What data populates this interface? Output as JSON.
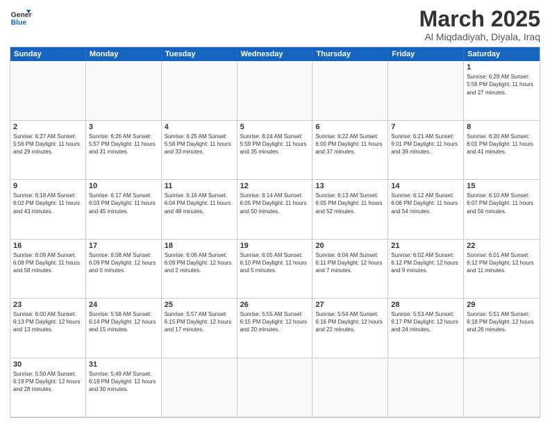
{
  "header": {
    "logo_general": "General",
    "logo_blue": "Blue",
    "month_title": "March 2025",
    "location": "Al Miqdadiyah, Diyala, Iraq"
  },
  "weekdays": [
    "Sunday",
    "Monday",
    "Tuesday",
    "Wednesday",
    "Thursday",
    "Friday",
    "Saturday"
  ],
  "cells": [
    {
      "day": "",
      "info": ""
    },
    {
      "day": "",
      "info": ""
    },
    {
      "day": "",
      "info": ""
    },
    {
      "day": "",
      "info": ""
    },
    {
      "day": "",
      "info": ""
    },
    {
      "day": "",
      "info": ""
    },
    {
      "day": "1",
      "info": "Sunrise: 6:29 AM\nSunset: 5:56 PM\nDaylight: 11 hours\nand 27 minutes."
    },
    {
      "day": "2",
      "info": "Sunrise: 6:27 AM\nSunset: 5:56 PM\nDaylight: 11 hours\nand 29 minutes."
    },
    {
      "day": "3",
      "info": "Sunrise: 6:26 AM\nSunset: 5:57 PM\nDaylight: 11 hours\nand 31 minutes."
    },
    {
      "day": "4",
      "info": "Sunrise: 6:25 AM\nSunset: 5:58 PM\nDaylight: 11 hours\nand 33 minutes."
    },
    {
      "day": "5",
      "info": "Sunrise: 6:24 AM\nSunset: 5:59 PM\nDaylight: 11 hours\nand 35 minutes."
    },
    {
      "day": "6",
      "info": "Sunrise: 6:22 AM\nSunset: 6:00 PM\nDaylight: 11 hours\nand 37 minutes."
    },
    {
      "day": "7",
      "info": "Sunrise: 6:21 AM\nSunset: 6:01 PM\nDaylight: 11 hours\nand 39 minutes."
    },
    {
      "day": "8",
      "info": "Sunrise: 6:20 AM\nSunset: 6:01 PM\nDaylight: 11 hours\nand 41 minutes."
    },
    {
      "day": "9",
      "info": "Sunrise: 6:18 AM\nSunset: 6:02 PM\nDaylight: 11 hours\nand 43 minutes."
    },
    {
      "day": "10",
      "info": "Sunrise: 6:17 AM\nSunset: 6:03 PM\nDaylight: 11 hours\nand 45 minutes."
    },
    {
      "day": "11",
      "info": "Sunrise: 6:16 AM\nSunset: 6:04 PM\nDaylight: 11 hours\nand 48 minutes."
    },
    {
      "day": "12",
      "info": "Sunrise: 6:14 AM\nSunset: 6:05 PM\nDaylight: 11 hours\nand 50 minutes."
    },
    {
      "day": "13",
      "info": "Sunrise: 6:13 AM\nSunset: 6:05 PM\nDaylight: 11 hours\nand 52 minutes."
    },
    {
      "day": "14",
      "info": "Sunrise: 6:12 AM\nSunset: 6:06 PM\nDaylight: 11 hours\nand 54 minutes."
    },
    {
      "day": "15",
      "info": "Sunrise: 6:10 AM\nSunset: 6:07 PM\nDaylight: 11 hours\nand 56 minutes."
    },
    {
      "day": "16",
      "info": "Sunrise: 6:09 AM\nSunset: 6:08 PM\nDaylight: 11 hours\nand 58 minutes."
    },
    {
      "day": "17",
      "info": "Sunrise: 6:08 AM\nSunset: 6:09 PM\nDaylight: 12 hours\nand 0 minutes."
    },
    {
      "day": "18",
      "info": "Sunrise: 6:06 AM\nSunset: 6:09 PM\nDaylight: 12 hours\nand 2 minutes."
    },
    {
      "day": "19",
      "info": "Sunrise: 6:05 AM\nSunset: 6:10 PM\nDaylight: 12 hours\nand 5 minutes."
    },
    {
      "day": "20",
      "info": "Sunrise: 6:04 AM\nSunset: 6:11 PM\nDaylight: 12 hours\nand 7 minutes."
    },
    {
      "day": "21",
      "info": "Sunrise: 6:02 AM\nSunset: 6:12 PM\nDaylight: 12 hours\nand 9 minutes."
    },
    {
      "day": "22",
      "info": "Sunrise: 6:01 AM\nSunset: 6:12 PM\nDaylight: 12 hours\nand 11 minutes."
    },
    {
      "day": "23",
      "info": "Sunrise: 6:00 AM\nSunset: 6:13 PM\nDaylight: 12 hours\nand 13 minutes."
    },
    {
      "day": "24",
      "info": "Sunrise: 5:58 AM\nSunset: 6:14 PM\nDaylight: 12 hours\nand 15 minutes."
    },
    {
      "day": "25",
      "info": "Sunrise: 5:57 AM\nSunset: 6:15 PM\nDaylight: 12 hours\nand 17 minutes."
    },
    {
      "day": "26",
      "info": "Sunrise: 5:55 AM\nSunset: 6:15 PM\nDaylight: 12 hours\nand 20 minutes."
    },
    {
      "day": "27",
      "info": "Sunrise: 5:54 AM\nSunset: 6:16 PM\nDaylight: 12 hours\nand 22 minutes."
    },
    {
      "day": "28",
      "info": "Sunrise: 5:53 AM\nSunset: 6:17 PM\nDaylight: 12 hours\nand 24 minutes."
    },
    {
      "day": "29",
      "info": "Sunrise: 5:51 AM\nSunset: 6:18 PM\nDaylight: 12 hours\nand 26 minutes."
    },
    {
      "day": "30",
      "info": "Sunrise: 5:50 AM\nSunset: 6:19 PM\nDaylight: 12 hours\nand 28 minutes."
    },
    {
      "day": "31",
      "info": "Sunrise: 5:49 AM\nSunset: 6:19 PM\nDaylight: 12 hours\nand 30 minutes."
    },
    {
      "day": "",
      "info": ""
    },
    {
      "day": "",
      "info": ""
    },
    {
      "day": "",
      "info": ""
    },
    {
      "day": "",
      "info": ""
    },
    {
      "day": "",
      "info": ""
    }
  ]
}
